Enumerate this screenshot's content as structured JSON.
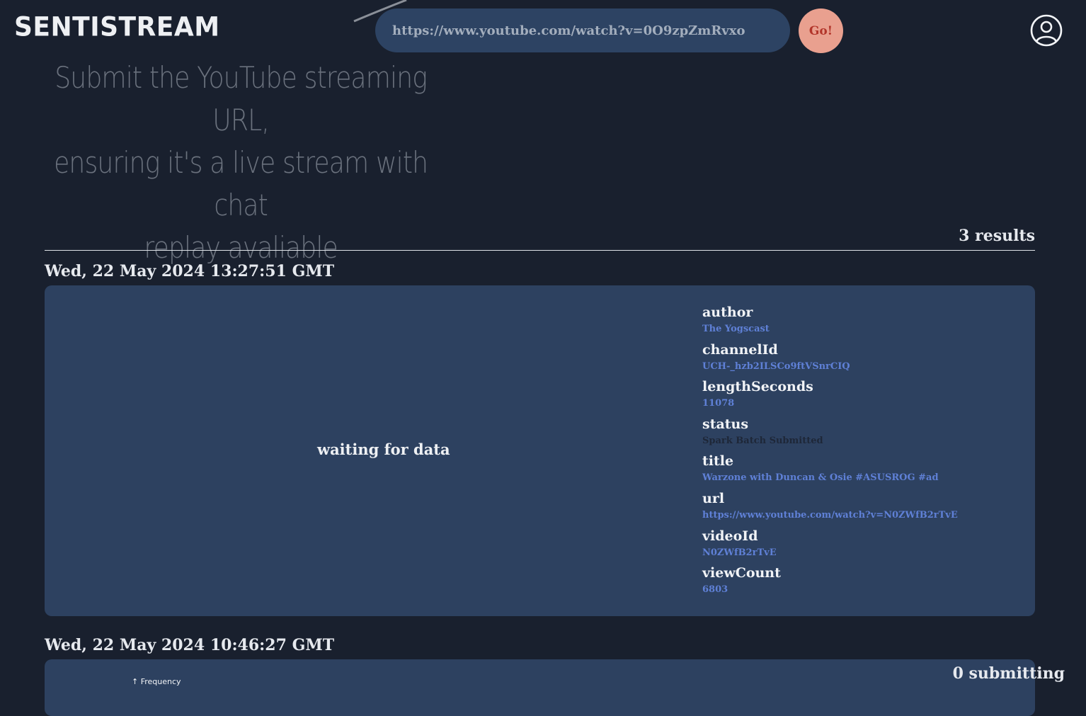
{
  "header": {
    "logo": "SENTISTREAM",
    "url_input": {
      "value": "",
      "placeholder": "https://www.youtube.com/watch?v=0O9zpZmRvxo"
    },
    "go_label": "Go!"
  },
  "hint_lines": [
    "Submit the YouTube streaming URL,",
    "ensuring it's a live stream with chat",
    "replay avaliable"
  ],
  "results": {
    "count_label": "3 results",
    "entries": [
      {
        "date": "Wed, 22 May 2024 13:27:51 GMT",
        "placeholder": "waiting for data",
        "meta": [
          {
            "key": "author",
            "value": "The Yogscast",
            "tone": "link"
          },
          {
            "key": "channelId",
            "value": "UCH-_hzb2ILSCo9ftVSnrCIQ",
            "tone": "link"
          },
          {
            "key": "lengthSeconds",
            "value": "11078",
            "tone": "link"
          },
          {
            "key": "status",
            "value": "Spark Batch Submitted",
            "tone": "dark"
          },
          {
            "key": "title",
            "value": "Warzone with Duncan & Osie #ASUSROG #ad",
            "tone": "link"
          },
          {
            "key": "url",
            "value": "https://www.youtube.com/watch?v=N0ZWfB2rTvE",
            "tone": "link"
          },
          {
            "key": "videoId",
            "value": "N0ZWfB2rTvE",
            "tone": "link"
          },
          {
            "key": "viewCount",
            "value": "6803",
            "tone": "link"
          }
        ]
      },
      {
        "date": "Wed, 22 May 2024 10:46:27 GMT",
        "chart_label": "↑ Frequency"
      }
    ]
  },
  "footer": {
    "submitting_label": "0 submitting"
  },
  "colors": {
    "background": "#19202e",
    "card": "#2d4160",
    "input": "#2d4363",
    "go_button": "#e9a08f",
    "go_text": "#b2352a",
    "link": "#5f80d6"
  }
}
